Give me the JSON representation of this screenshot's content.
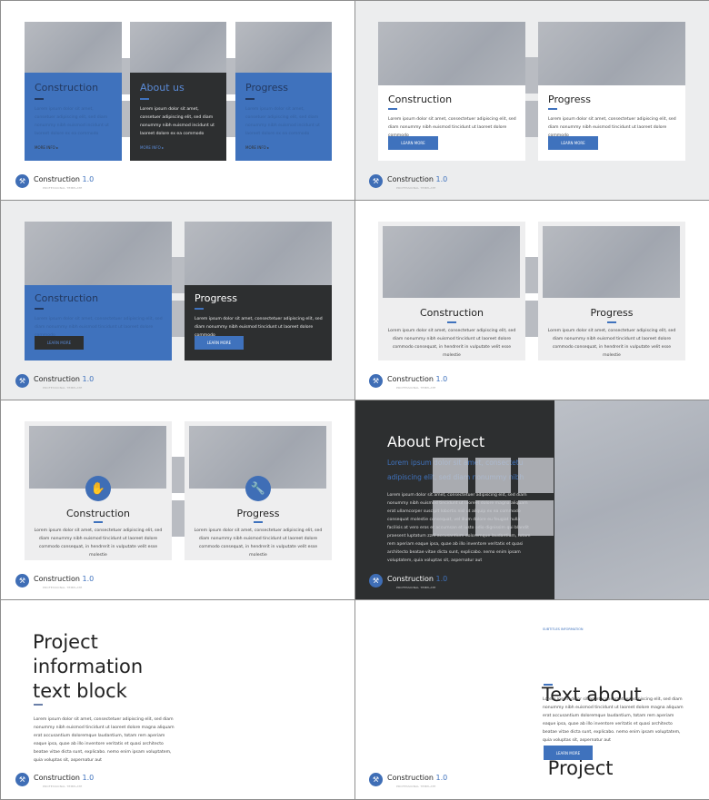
{
  "footer": {
    "brand": "Construction",
    "version": "1.0",
    "subtitle": "PROFESSIONAL TEMPLATE",
    "icon": "hammer-icon"
  },
  "colors": {
    "accent": "#3f72bd",
    "dark": "#2d2f30",
    "panel": "#ecedee"
  },
  "lorem_short": "Lorem ipsum dolor sit amet, consetuer adipiscing elit, sed diam nonummy nibh euismod incidunt ut laoreet dolore ex ea commodo consequat, in hendrerit",
  "lorem_card": "Lorem ipsum dolor sit amet, consectetuer adipiscing elit, sed diam nonummy nibh euismod tincidunt ut laoreet dolore commodo",
  "lorem_card2": "Lorem ipsum dolor sit amet, consectetuer adipiscing elit, sed diam nonummy nibh euismod tincidunt ut laoreet dolore commodo consequat, in hendrerit in vulputate velit esse molestie",
  "lorem_long": "Lorem ipsum dolor sit amet, consectetuer adipiscing elit, sed diam nonummy nibh euismod tincidunt ut laoreet dolore magna aliquam erat accusantium doloremque laudantium, totam rem aperiam eaque ipsa, quae ab illo inventore veritatis et quasi architecto beatae vitae dicta sunt, explicabo. nemo enim ipsam voluptatem, quia voluptas sit, aspernatur aut",
  "lorem_dark": "Lorem ipsum dolor sit amet, consectetuer adipiscing elit, sed diam nonummy nibh euismod tincidunt ut laoreet dolore magna aliquam erat ullamcorper suscipit lobortis nisl ut aliquip ex ea commodo consequat molestie consequat, vel illum dolore eu feugiat nulla facilisis at vero eros et accumsan et iusto odio dignissim qui blandit praesent luptatum zzril accusantium doloremque laudantium, totam rem aperiam eaque ipsa, quae ab illo inventore veritatis et quasi architecto beatae vitae dicta sunt, explicabo. nemo enim ipsam voluptatem, quia voluptas sit, aspernatur aut",
  "slide1": {
    "cards": [
      "Construction",
      "About us",
      "Progress"
    ],
    "more_info": "MORE INFO ▸"
  },
  "slide2": {
    "cards": [
      "Construction",
      "Progress"
    ],
    "button": "LEARN MORE"
  },
  "slide3": {
    "cards": [
      "Construction",
      "Progress"
    ],
    "button": "LEARN MORE"
  },
  "slide4": {
    "cards": [
      "Construction",
      "Progress"
    ]
  },
  "slide5": {
    "cards": [
      "Construction",
      "Progress"
    ],
    "icons": [
      "handshake-icon",
      "wrench-icon"
    ]
  },
  "slide6": {
    "title": "About Project",
    "subtitle": "Lorem ipsum dolor sit amet, consectetu adipiscing elit, sed diam nonummy nibh"
  },
  "slide7": {
    "title_lines": [
      "Project",
      "information",
      "text block"
    ]
  },
  "slide8": {
    "eyebrow": "SUBTITLES INFORMATION",
    "title_lines": [
      "Text about",
      " Project"
    ],
    "button": "LEARN MORE"
  }
}
